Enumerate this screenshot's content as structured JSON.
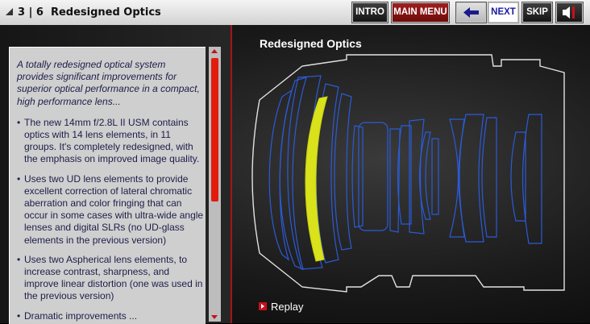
{
  "header": {
    "slide_counter": "3 | 6",
    "slide_title": "Redesigned Optics",
    "buttons": {
      "intro": "INTRO",
      "main_menu": "MAIN MENU",
      "next": "NEXT",
      "skip": "SKIP"
    },
    "icons": {
      "back": "back-arrow-icon",
      "sound": "speaker-muted-icon"
    }
  },
  "text_panel": {
    "intro": "A totally redesigned optical system provides significant improvements for superior optical performance in a compact, high performance lens...",
    "bullets": [
      "The new 14mm f/2.8L II USM contains optics with 14 lens elements, in 11 groups.  It's completely redesigned, with the emphasis on improved image quality.",
      "Uses two UD lens elements to provide excellent correction of lateral chromatic aberration and color fringing that can occur in some cases with ultra-wide angle lenses and digital SLRs  (no UD-glass elements in the previous version)",
      "Uses two Aspherical lens elements, to increase contrast, sharpness, and improve linear distortion (one was used in the previous version)",
      "Dramatic improvements ..."
    ]
  },
  "diagram": {
    "title": "Redesigned Optics",
    "colors": {
      "outline": "#e2e2e2",
      "lens": "#2a5bd7",
      "highlight": "#d9e21a"
    }
  },
  "replay": {
    "label": "Replay"
  },
  "colors": {
    "accent": "#c8101a",
    "menu_button": "#8a1414",
    "scroll_thumb": "#e31b0d"
  }
}
